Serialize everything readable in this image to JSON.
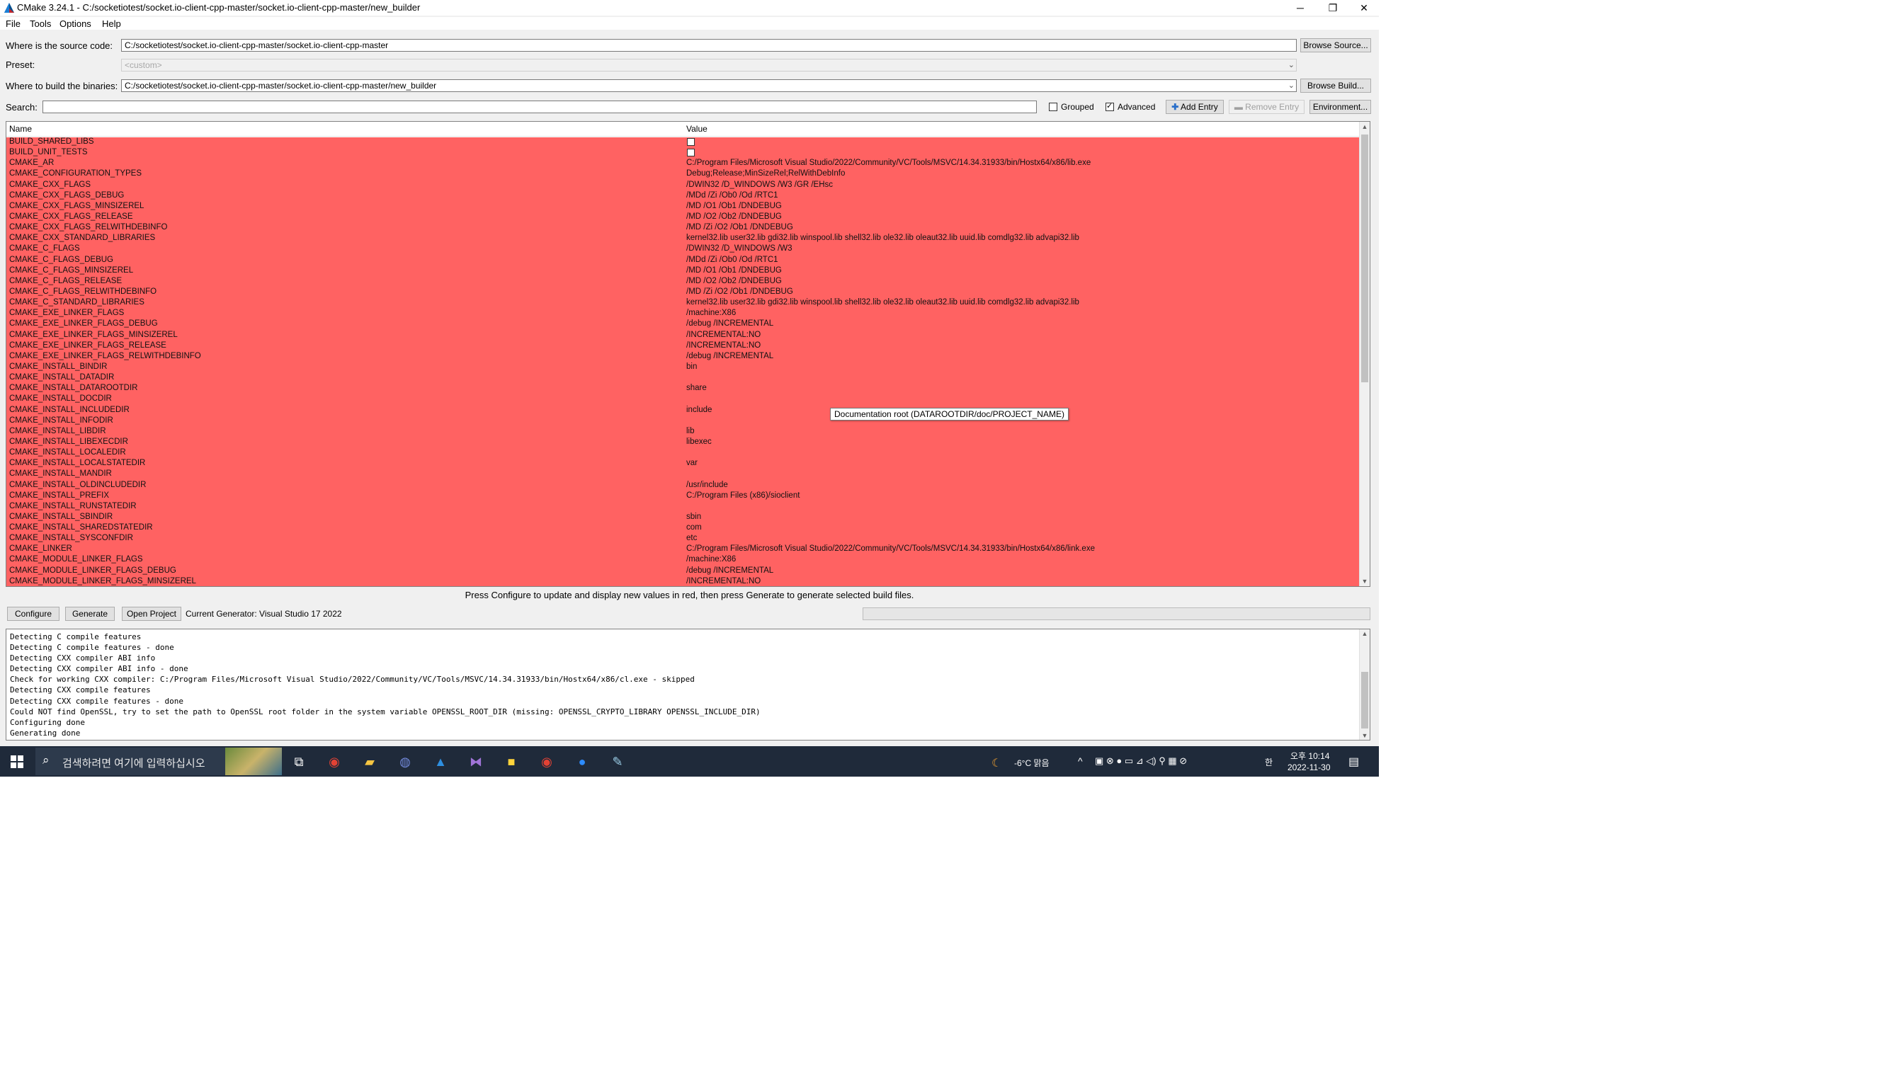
{
  "window": {
    "title": "CMake 3.24.1 - C:/socketiotest/socket.io-client-cpp-master/socket.io-client-cpp-master/new_builder",
    "minimize": "─",
    "restore": "❐",
    "close": "✕"
  },
  "menu": [
    "File",
    "Tools",
    "Options",
    "Help"
  ],
  "source": {
    "label": "Where is the source code:",
    "value": "C:/socketiotest/socket.io-client-cpp-master/socket.io-client-cpp-master",
    "button": "Browse Source..."
  },
  "preset": {
    "label": "Preset:",
    "value": "<custom>"
  },
  "binaries": {
    "label": "Where to build the binaries:",
    "value": "C:/socketiotest/socket.io-client-cpp-master/socket.io-client-cpp-master/new_builder",
    "button": "Browse Build..."
  },
  "search": {
    "label": "Search:",
    "value": "",
    "grouped_label": "Grouped",
    "grouped_checked": false,
    "advanced_label": "Advanced",
    "advanced_checked": true,
    "add_entry": "Add Entry",
    "remove_entry": "Remove Entry",
    "environment": "Environment..."
  },
  "table": {
    "headers": [
      "Name",
      "Value"
    ],
    "highlight_color": "#ff6262",
    "rows": [
      {
        "name": "BUILD_SHARED_LIBS",
        "value": "",
        "checkbox": true
      },
      {
        "name": "BUILD_UNIT_TESTS",
        "value": "",
        "checkbox": true
      },
      {
        "name": "CMAKE_AR",
        "value": "C:/Program Files/Microsoft Visual Studio/2022/Community/VC/Tools/MSVC/14.34.31933/bin/Hostx64/x86/lib.exe"
      },
      {
        "name": "CMAKE_CONFIGURATION_TYPES",
        "value": "Debug;Release;MinSizeRel;RelWithDebInfo"
      },
      {
        "name": "CMAKE_CXX_FLAGS",
        "value": "/DWIN32 /D_WINDOWS /W3 /GR /EHsc"
      },
      {
        "name": "CMAKE_CXX_FLAGS_DEBUG",
        "value": "/MDd /Zi /Ob0 /Od /RTC1"
      },
      {
        "name": "CMAKE_CXX_FLAGS_MINSIZEREL",
        "value": "/MD /O1 /Ob1 /DNDEBUG"
      },
      {
        "name": "CMAKE_CXX_FLAGS_RELEASE",
        "value": "/MD /O2 /Ob2 /DNDEBUG"
      },
      {
        "name": "CMAKE_CXX_FLAGS_RELWITHDEBINFO",
        "value": "/MD /Zi /O2 /Ob1 /DNDEBUG"
      },
      {
        "name": "CMAKE_CXX_STANDARD_LIBRARIES",
        "value": "kernel32.lib user32.lib gdi32.lib winspool.lib shell32.lib ole32.lib oleaut32.lib uuid.lib comdlg32.lib advapi32.lib"
      },
      {
        "name": "CMAKE_C_FLAGS",
        "value": "/DWIN32 /D_WINDOWS /W3"
      },
      {
        "name": "CMAKE_C_FLAGS_DEBUG",
        "value": "/MDd /Zi /Ob0 /Od /RTC1"
      },
      {
        "name": "CMAKE_C_FLAGS_MINSIZEREL",
        "value": "/MD /O1 /Ob1 /DNDEBUG"
      },
      {
        "name": "CMAKE_C_FLAGS_RELEASE",
        "value": "/MD /O2 /Ob2 /DNDEBUG"
      },
      {
        "name": "CMAKE_C_FLAGS_RELWITHDEBINFO",
        "value": "/MD /Zi /O2 /Ob1 /DNDEBUG"
      },
      {
        "name": "CMAKE_C_STANDARD_LIBRARIES",
        "value": "kernel32.lib user32.lib gdi32.lib winspool.lib shell32.lib ole32.lib oleaut32.lib uuid.lib comdlg32.lib advapi32.lib"
      },
      {
        "name": "CMAKE_EXE_LINKER_FLAGS",
        "value": "/machine:X86"
      },
      {
        "name": "CMAKE_EXE_LINKER_FLAGS_DEBUG",
        "value": "/debug /INCREMENTAL"
      },
      {
        "name": "CMAKE_EXE_LINKER_FLAGS_MINSIZEREL",
        "value": "/INCREMENTAL:NO"
      },
      {
        "name": "CMAKE_EXE_LINKER_FLAGS_RELEASE",
        "value": "/INCREMENTAL:NO"
      },
      {
        "name": "CMAKE_EXE_LINKER_FLAGS_RELWITHDEBINFO",
        "value": "/debug /INCREMENTAL"
      },
      {
        "name": "CMAKE_INSTALL_BINDIR",
        "value": "bin"
      },
      {
        "name": "CMAKE_INSTALL_DATADIR",
        "value": ""
      },
      {
        "name": "CMAKE_INSTALL_DATAROOTDIR",
        "value": "share"
      },
      {
        "name": "CMAKE_INSTALL_DOCDIR",
        "value": ""
      },
      {
        "name": "CMAKE_INSTALL_INCLUDEDIR",
        "value": "include"
      },
      {
        "name": "CMAKE_INSTALL_INFODIR",
        "value": ""
      },
      {
        "name": "CMAKE_INSTALL_LIBDIR",
        "value": "lib"
      },
      {
        "name": "CMAKE_INSTALL_LIBEXECDIR",
        "value": "libexec"
      },
      {
        "name": "CMAKE_INSTALL_LOCALEDIR",
        "value": ""
      },
      {
        "name": "CMAKE_INSTALL_LOCALSTATEDIR",
        "value": "var"
      },
      {
        "name": "CMAKE_INSTALL_MANDIR",
        "value": ""
      },
      {
        "name": "CMAKE_INSTALL_OLDINCLUDEDIR",
        "value": "/usr/include"
      },
      {
        "name": "CMAKE_INSTALL_PREFIX",
        "value": "C:/Program Files (x86)/sioclient"
      },
      {
        "name": "CMAKE_INSTALL_RUNSTATEDIR",
        "value": ""
      },
      {
        "name": "CMAKE_INSTALL_SBINDIR",
        "value": "sbin"
      },
      {
        "name": "CMAKE_INSTALL_SHAREDSTATEDIR",
        "value": "com"
      },
      {
        "name": "CMAKE_INSTALL_SYSCONFDIR",
        "value": "etc"
      },
      {
        "name": "CMAKE_LINKER",
        "value": "C:/Program Files/Microsoft Visual Studio/2022/Community/VC/Tools/MSVC/14.34.31933/bin/Hostx64/x86/link.exe"
      },
      {
        "name": "CMAKE_MODULE_LINKER_FLAGS",
        "value": "/machine:X86"
      },
      {
        "name": "CMAKE_MODULE_LINKER_FLAGS_DEBUG",
        "value": "/debug /INCREMENTAL"
      },
      {
        "name": "CMAKE_MODULE_LINKER_FLAGS_MINSIZEREL",
        "value": "/INCREMENTAL:NO"
      }
    ],
    "tooltip": "Documentation root (DATAROOTDIR/doc/PROJECT_NAME)"
  },
  "hint": "Press Configure to update and display new values in red, then press Generate to generate selected build files.",
  "actions": {
    "configure": "Configure",
    "generate": "Generate",
    "open_project": "Open Project",
    "generator": "Current Generator: Visual Studio 17 2022"
  },
  "output": [
    "Detecting C compile features",
    "Detecting C compile features - done",
    "Detecting CXX compiler ABI info",
    "Detecting CXX compiler ABI info - done",
    "Check for working CXX compiler: C:/Program Files/Microsoft Visual Studio/2022/Community/VC/Tools/MSVC/14.34.31933/bin/Hostx64/x86/cl.exe - skipped",
    "Detecting CXX compile features",
    "Detecting CXX compile features - done",
    "Could NOT find OpenSSL, try to set the path to OpenSSL root folder in the system variable OPENSSL_ROOT_DIR (missing: OPENSSL_CRYPTO_LIBRARY OPENSSL_INCLUDE_DIR)",
    "Configuring done",
    "Generating done"
  ],
  "taskbar": {
    "search_placeholder": "검색하려면 여기에 입력하십시오",
    "weather": "-6°C  맑음",
    "time": "오후 10:14",
    "date": "2022-11-30",
    "ime": "한"
  }
}
